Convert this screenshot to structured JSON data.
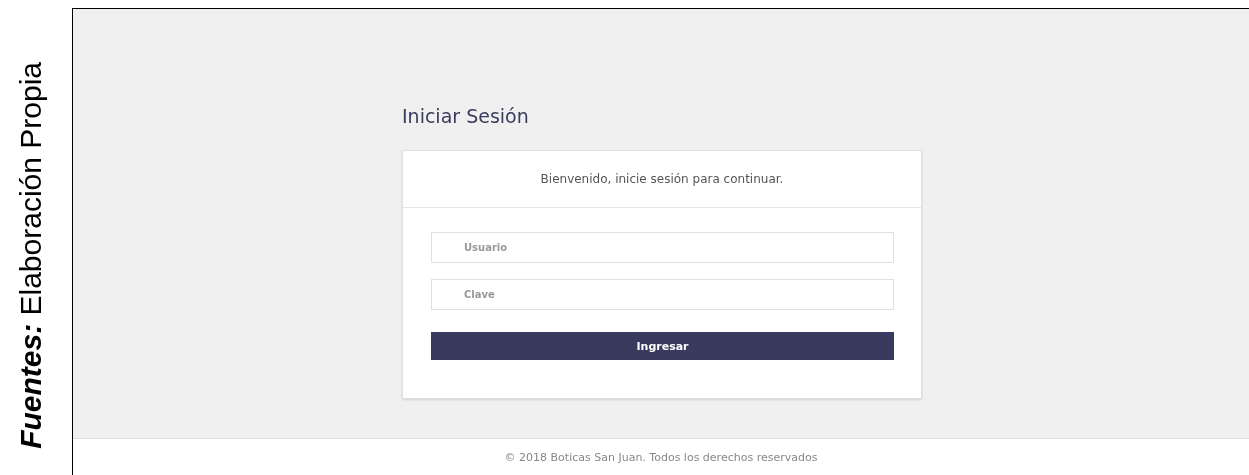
{
  "caption": "**Fuentes:** Elaboración Propia",
  "page": {
    "title": "Iniciar Sesión"
  },
  "login_card": {
    "message": "Bienvenido, inicie sesión para continuar.",
    "fields": [
      {
        "placeholder": "Usuario"
      },
      {
        "placeholder": "Clave"
      }
    ],
    "submit_button": "Ingresar"
  },
  "footer": "© 2018 Boticas San Juan. Todos los derechos reservados"
}
